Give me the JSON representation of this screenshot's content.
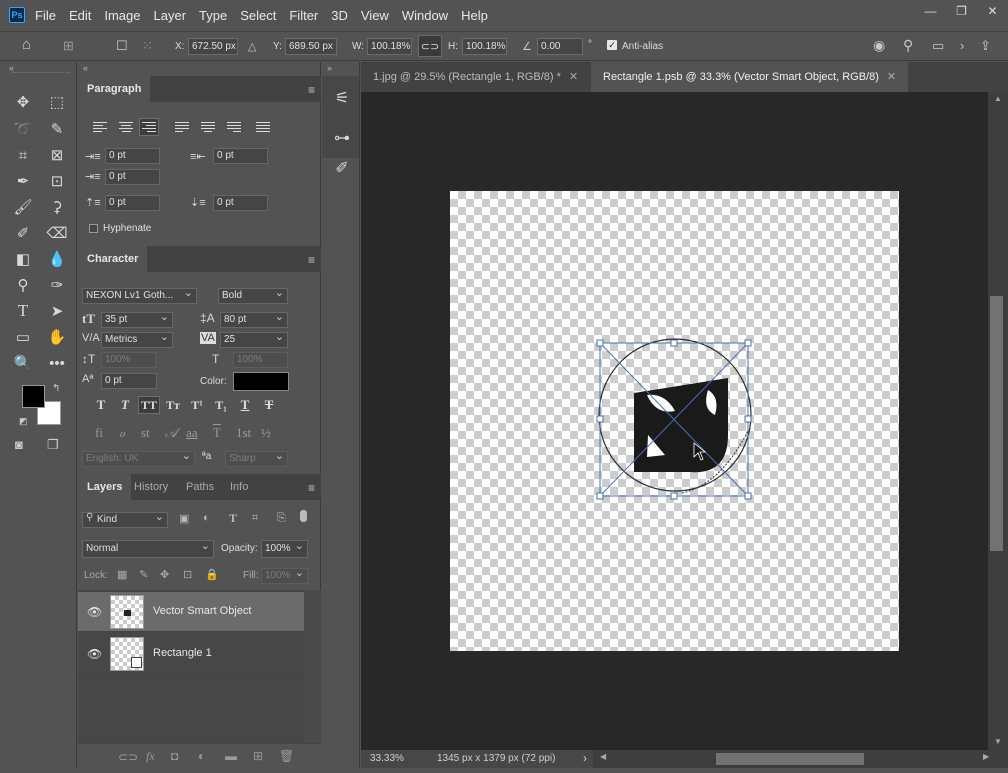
{
  "menubar": {
    "logo": "Ps",
    "items": [
      "File",
      "Edit",
      "Image",
      "Layer",
      "Type",
      "Select",
      "Filter",
      "3D",
      "View",
      "Window",
      "Help"
    ],
    "controls": [
      "minimize-icon",
      "restore-icon",
      "close-icon"
    ]
  },
  "options_bar": {
    "x_label": "X:",
    "x_value": "672.50 px",
    "y_label": "Y:",
    "y_value": "689.50 px",
    "w_label": "W:",
    "w_value": "100.18%",
    "h_label": "H:",
    "h_value": "100.18%",
    "angle_value": "0.00",
    "angle_unit": "°",
    "antialias_label": "Anti-alias",
    "antialias_checked": true
  },
  "paragraph_panel": {
    "tab": "Paragraph",
    "indent_left": "0 pt",
    "indent_right": "0 pt",
    "indent_first": "0 pt",
    "space_before": "0 pt",
    "space_after": "0 pt",
    "hyphenate_label": "Hyphenate",
    "hyphenate_checked": false
  },
  "character_panel": {
    "tab": "Character",
    "font_family": "NEXON Lv1 Goth...",
    "font_style": "Bold",
    "font_size": "35 pt",
    "leading": "80 pt",
    "kerning": "Metrics",
    "tracking": "25",
    "vertical_scale": "100%",
    "horizontal_scale": "100%",
    "baseline_shift": "0 pt",
    "color_label": "Color:",
    "color": "#000000",
    "language": "English: UK",
    "aa_label": "ªa",
    "antialias_method": "Sharp",
    "style_buttons": [
      "T",
      "T",
      "TT",
      "Tт",
      "T¹",
      "T₁",
      "T",
      "T"
    ],
    "opentype_buttons": [
      "fi",
      "ℴ",
      "st",
      "𝒜",
      "aa",
      "T",
      "1st",
      "½"
    ]
  },
  "layers_panel": {
    "tabs": [
      "Layers",
      "History",
      "Paths",
      "Info"
    ],
    "filter_label": "Kind",
    "blend_mode": "Normal",
    "opacity_label": "Opacity:",
    "opacity_value": "100%",
    "lock_label": "Lock:",
    "fill_label": "Fill:",
    "fill_value": "100%",
    "layers": [
      {
        "name": "Vector Smart Object",
        "selected": true
      },
      {
        "name": "Rectangle 1",
        "selected": false
      }
    ]
  },
  "documents": {
    "tabs": [
      {
        "label": "1.jpg @ 29.5% (Rectangle 1, RGB/8) *",
        "active": false
      },
      {
        "label": "Rectangle 1.psb @ 33.3% (Vector Smart Object, RGB/8)",
        "active": true
      }
    ]
  },
  "status": {
    "zoom": "33.33%",
    "doc_info": "1345 px x 1379 px (72 ppi)"
  },
  "colors": {
    "foreground": "#000000",
    "background": "#ffffff",
    "selection_accent": "#4a6fb5"
  }
}
